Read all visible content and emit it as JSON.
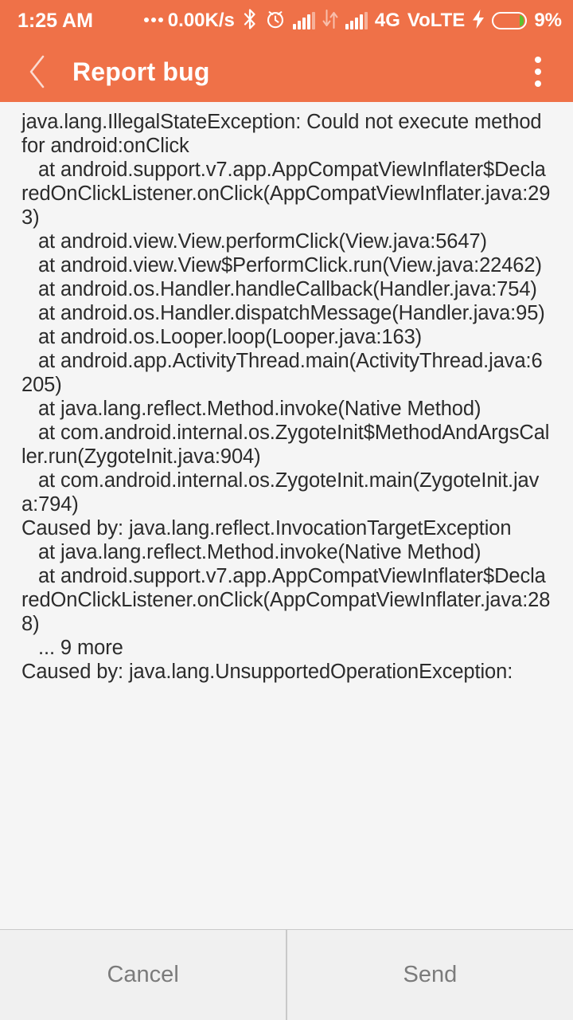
{
  "theme": {
    "accent": "#EF7148",
    "content_bg": "#F5F5F5",
    "button_bar_bg": "#F0F0F0",
    "text_color": "#2B2B2B",
    "button_text_color": "#7B7B7B",
    "battery_fill": "#5BC22E"
  },
  "status_bar": {
    "time": "1:25 AM",
    "network_speed": "0.00K/s",
    "icons": [
      "three-dots-icon",
      "bluetooth-icon",
      "alarm-clock-icon",
      "signal-bars-sim1-icon",
      "data-transfer-icon",
      "signal-bars-sim2-icon"
    ],
    "network_type": "4G",
    "volte_label": "VoLTE",
    "charging": true,
    "battery_percent": "9%"
  },
  "app_bar": {
    "back_label": "back",
    "title": "Report bug",
    "overflow_label": "more options"
  },
  "content": {
    "stacktrace": "java.lang.IllegalStateException: Could not execute method for android:onClick\n   at android.support.v7.app.AppCompatViewInflater$DeclaredOnClickListener.onClick(AppCompatViewInflater.java:293)\n   at android.view.View.performClick(View.java:5647)\n   at android.view.View$PerformClick.run(View.java:22462)\n   at android.os.Handler.handleCallback(Handler.java:754)\n   at android.os.Handler.dispatchMessage(Handler.java:95)\n   at android.os.Looper.loop(Looper.java:163)\n   at android.app.ActivityThread.main(ActivityThread.java:6205)\n   at java.lang.reflect.Method.invoke(Native Method)\n   at com.android.internal.os.ZygoteInit$MethodAndArgsCaller.run(ZygoteInit.java:904)\n   at com.android.internal.os.ZygoteInit.main(ZygoteInit.java:794)\nCaused by: java.lang.reflect.InvocationTargetException\n   at java.lang.reflect.Method.invoke(Native Method)\n   at android.support.v7.app.AppCompatViewInflater$DeclaredOnClickListener.onClick(AppCompatViewInflater.java:288)\n   ... 9 more\nCaused by: java.lang.UnsupportedOperationException:"
  },
  "buttons": {
    "cancel_label": "Cancel",
    "send_label": "Send"
  }
}
